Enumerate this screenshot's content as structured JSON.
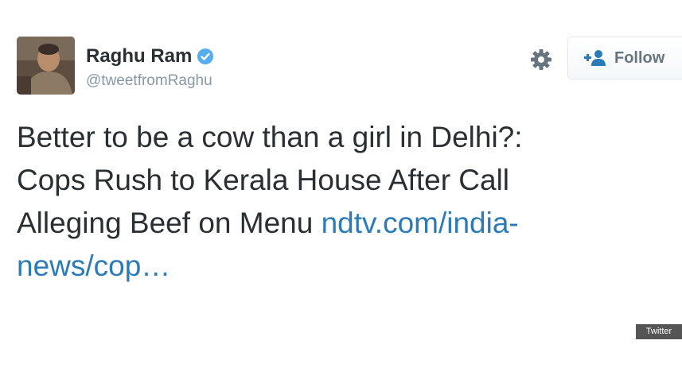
{
  "profile": {
    "display_name": "Raghu Ram",
    "handle": "@tweetfromRaghu",
    "avatar_icon": "profile-photo",
    "verified_icon": "verified-badge-icon",
    "verified_color": "#55acee"
  },
  "actions": {
    "settings_icon": "gear-icon",
    "follow_icon": "add-user-icon",
    "follow_label": "Follow"
  },
  "tweet": {
    "line_1": "Better to be a cow than a girl in Delhi?:",
    "line_2": "Cops Rush to Kerala House After Call",
    "line_3_text": "Alleging Beef on Menu ",
    "link_part_1": "ndtv.com/india-",
    "link_part_2": "news/cop…",
    "link_color": "#2b7bb9"
  },
  "credit": {
    "label": "Twitter"
  }
}
